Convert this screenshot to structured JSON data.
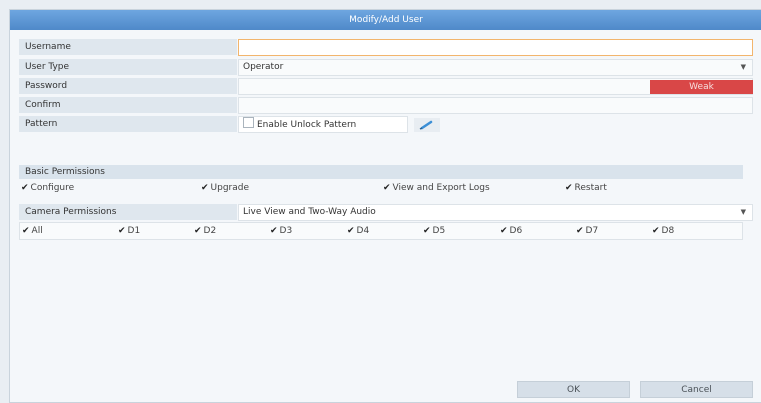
{
  "dialog": {
    "title": "Modify/Add User"
  },
  "form": {
    "username": {
      "label": "Username",
      "value": ""
    },
    "user_type": {
      "label": "User Type",
      "value": "Operator"
    },
    "password": {
      "label": "Password",
      "value": "",
      "strength": "Weak"
    },
    "confirm": {
      "label": "Confirm",
      "value": ""
    },
    "pattern": {
      "label": "Pattern",
      "checkbox_label": "Enable Unlock Pattern",
      "checked": false
    }
  },
  "basic_permissions": {
    "heading": "Basic Permissions",
    "items": [
      {
        "label": "Configure",
        "checked": true
      },
      {
        "label": "Upgrade",
        "checked": true
      },
      {
        "label": "View and Export Logs",
        "checked": true
      },
      {
        "label": "Restart",
        "checked": true
      }
    ]
  },
  "camera_permissions": {
    "label": "Camera Permissions",
    "selected": "Live View and Two-Way Audio",
    "channels": [
      {
        "label": "All",
        "checked": true
      },
      {
        "label": "D1",
        "checked": true
      },
      {
        "label": "D2",
        "checked": true
      },
      {
        "label": "D3",
        "checked": true
      },
      {
        "label": "D4",
        "checked": true
      },
      {
        "label": "D5",
        "checked": true
      },
      {
        "label": "D6",
        "checked": true
      },
      {
        "label": "D7",
        "checked": true
      },
      {
        "label": "D8",
        "checked": true
      }
    ]
  },
  "buttons": {
    "ok": "OK",
    "cancel": "Cancel"
  },
  "icons": {
    "dropdown": "chevron-down-icon",
    "check": "checkmark-icon",
    "edit": "pencil-icon"
  },
  "colors": {
    "title_bar": "#5b95d4",
    "weak": "#d94747",
    "focus_border": "#f2b56d"
  }
}
